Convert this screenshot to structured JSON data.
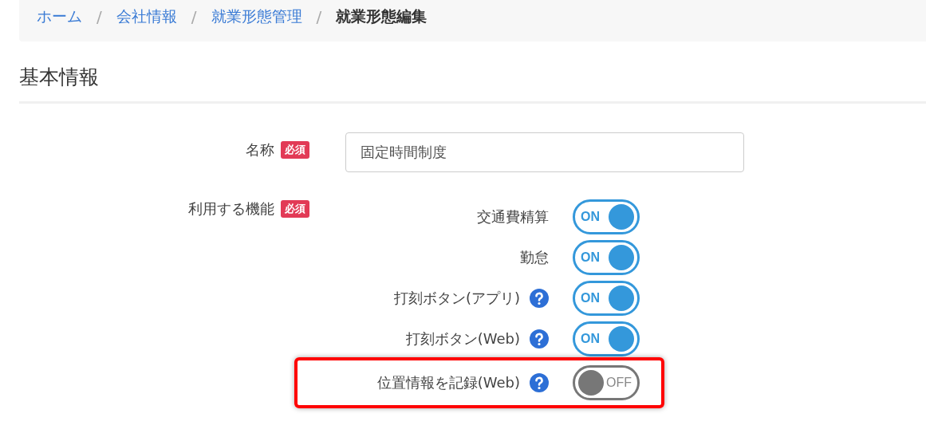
{
  "breadcrumb": [
    {
      "label": "ホーム",
      "current": false
    },
    {
      "label": "会社情報",
      "current": false
    },
    {
      "label": "就業形態管理",
      "current": false
    },
    {
      "label": "就業形態編集",
      "current": true
    }
  ],
  "breadcrumb_separator": "/",
  "section_title": "基本情報",
  "fields": [
    {
      "kind": "text",
      "label": "名称",
      "badge": "必須",
      "value": "固定時間制度"
    },
    {
      "kind": "switches",
      "label": "利用する機能",
      "badge": "必須",
      "items": [
        {
          "label": "交通費精算",
          "help": false,
          "on": true,
          "switch_label": "ON",
          "highlighted": false
        },
        {
          "label": "勤怠",
          "help": false,
          "on": true,
          "switch_label": "ON",
          "highlighted": false
        },
        {
          "label": "打刻ボタン(アプリ)",
          "help": true,
          "on": true,
          "switch_label": "ON",
          "highlighted": false
        },
        {
          "label": "打刻ボタン(Web)",
          "help": true,
          "on": true,
          "switch_label": "ON",
          "highlighted": false
        },
        {
          "label": "位置情報を記録(Web)",
          "help": true,
          "on": false,
          "switch_label": "OFF",
          "highlighted": true
        }
      ]
    }
  ]
}
